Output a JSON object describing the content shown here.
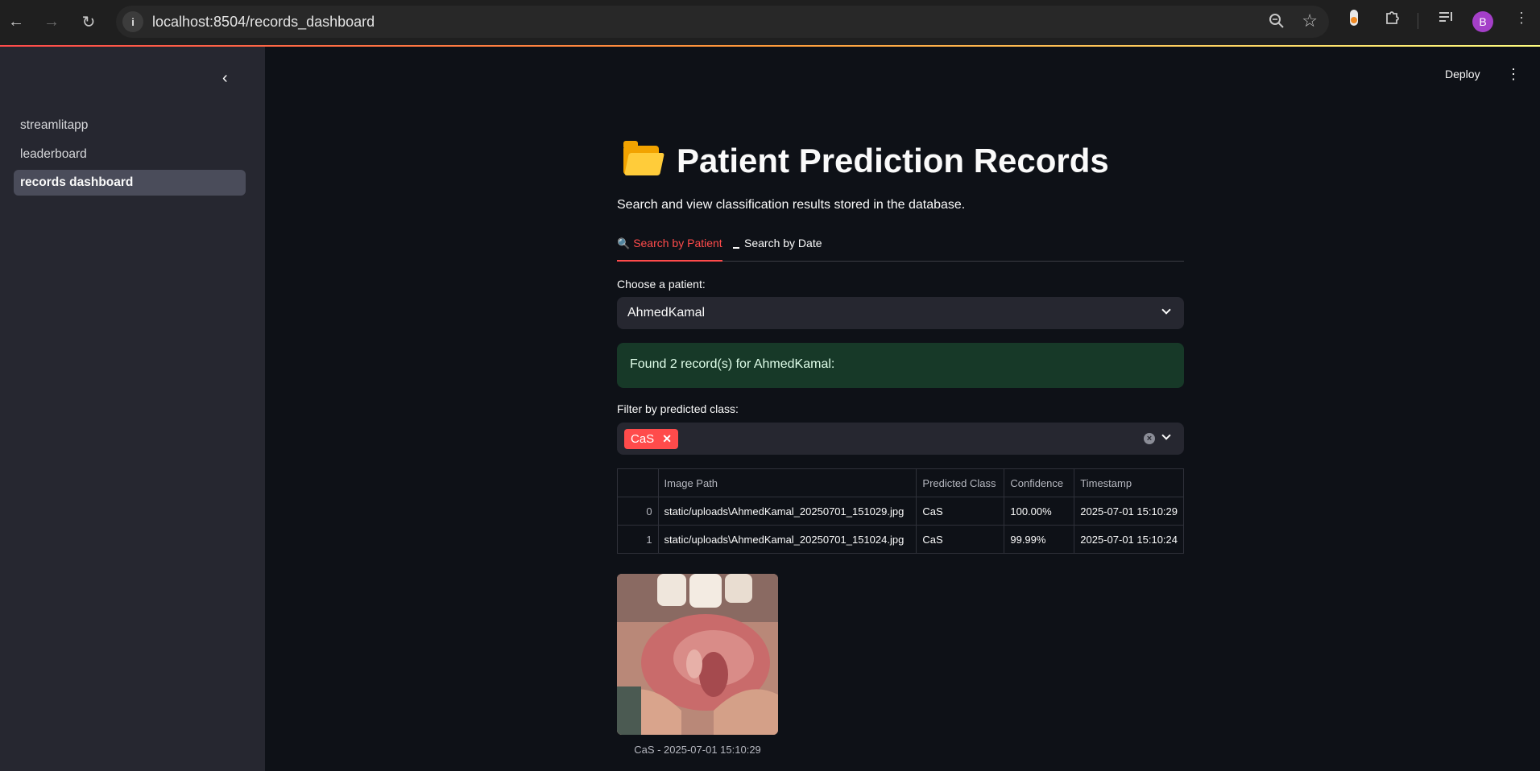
{
  "browser": {
    "url": "localhost:8504/records_dashboard",
    "profile_initial": "B"
  },
  "sidebar": {
    "items": [
      {
        "label": "streamlitapp"
      },
      {
        "label": "leaderboard"
      },
      {
        "label": "records dashboard"
      }
    ]
  },
  "header": {
    "deploy_label": "Deploy"
  },
  "main": {
    "title": "Patient Prediction Records",
    "subtitle": "Search and view classification results stored in the database.",
    "tabs": [
      {
        "label": "Search by Patient",
        "icon": "magnifier-icon",
        "active": true
      },
      {
        "label": "Search by Date",
        "icon": "calendar-icon",
        "active": false
      }
    ],
    "patient_label": "Choose a patient:",
    "patient_value": "AhmedKamal",
    "success_message": "Found 2 record(s) for AhmedKamal:",
    "filter_label": "Filter by predicted class:",
    "filter_chips": [
      "CaS"
    ],
    "table": {
      "columns": [
        "",
        "Image Path",
        "Predicted Class",
        "Confidence",
        "Timestamp"
      ],
      "rows": [
        [
          "0",
          "static/uploads\\AhmedKamal_20250701_151029.jpg",
          "CaS",
          "100.00%",
          "2025-07-01 15:10:29"
        ],
        [
          "1",
          "static/uploads\\AhmedKamal_20250701_151024.jpg",
          "CaS",
          "99.99%",
          "2025-07-01 15:10:24"
        ]
      ]
    },
    "image_caption": "CaS - 2025-07-01 15:10:29"
  },
  "colors": {
    "accent": "#ff4b4b",
    "background": "#0e1117",
    "sidebar": "#262730",
    "success_bg": "#173928"
  }
}
